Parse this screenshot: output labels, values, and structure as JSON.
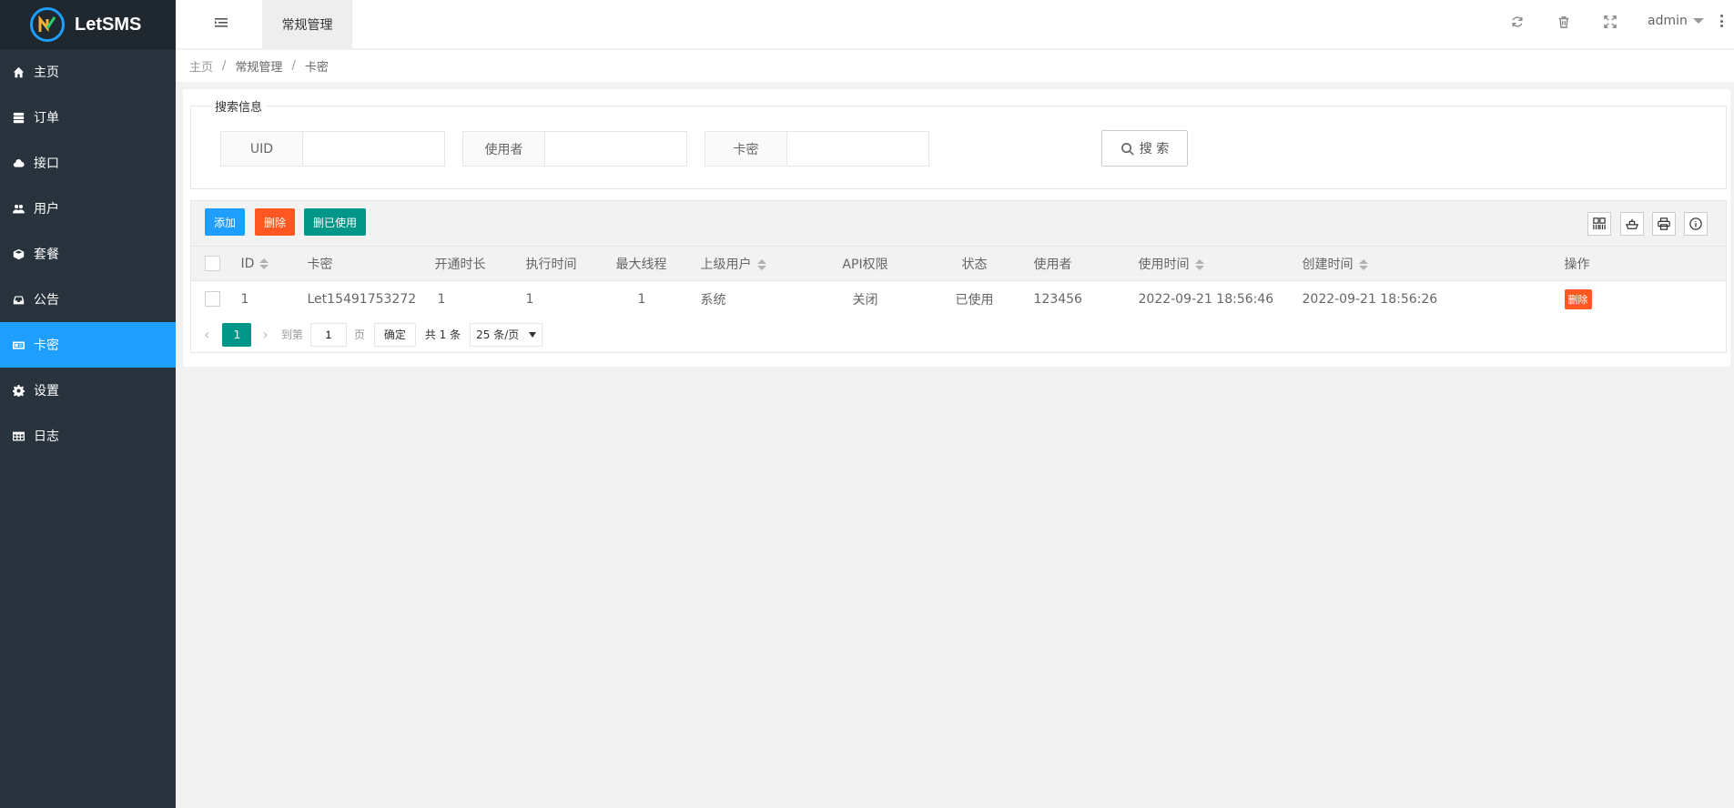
{
  "app": {
    "title": "LetSMS"
  },
  "sidebar": {
    "items": [
      {
        "label": "主页",
        "icon": "home-icon"
      },
      {
        "label": "订单",
        "icon": "server-icon"
      },
      {
        "label": "接口",
        "icon": "cloud-icon"
      },
      {
        "label": "用户",
        "icon": "users-icon"
      },
      {
        "label": "套餐",
        "icon": "cube-icon"
      },
      {
        "label": "公告",
        "icon": "inbox-icon"
      },
      {
        "label": "卡密",
        "icon": "id-card-icon",
        "active": true
      },
      {
        "label": "设置",
        "icon": "gear-icon"
      },
      {
        "label": "日志",
        "icon": "table-icon"
      }
    ]
  },
  "header": {
    "tab": "常规管理",
    "user": "admin"
  },
  "breadcrumb": [
    "主页",
    "常规管理",
    "卡密"
  ],
  "search": {
    "legend": "搜索信息",
    "fields": [
      {
        "label": "UID",
        "value": ""
      },
      {
        "label": "使用者",
        "value": ""
      },
      {
        "label": "卡密",
        "value": ""
      }
    ],
    "button": "搜 索"
  },
  "toolbar": {
    "add": "添加",
    "delete": "删除",
    "delete_used": "删已使用"
  },
  "table": {
    "columns": [
      "ID",
      "卡密",
      "开通时长",
      "执行时间",
      "最大线程",
      "上级用户",
      "API权限",
      "状态",
      "使用者",
      "使用时间",
      "创建时间",
      "操作"
    ],
    "rows": [
      {
        "id": "1",
        "card": "Let15491753272",
        "duration": "1",
        "exec_time": "1",
        "max_threads": "1",
        "parent": "系统",
        "api": "关闭",
        "status": "已使用",
        "user": "123456",
        "used_at": "2022-09-21 18:56:46",
        "created_at": "2022-09-21 18:56:26",
        "action": "删除"
      }
    ]
  },
  "pager": {
    "current": "1",
    "goto_label": "到第",
    "goto_value": "1",
    "page_unit": "页",
    "ok": "确定",
    "total": "共 1 条",
    "page_size": "25 条/页"
  },
  "colors": {
    "accent": "#1e9fff",
    "danger": "#ff5722",
    "success": "#009688",
    "sidebar": "#28333e"
  }
}
